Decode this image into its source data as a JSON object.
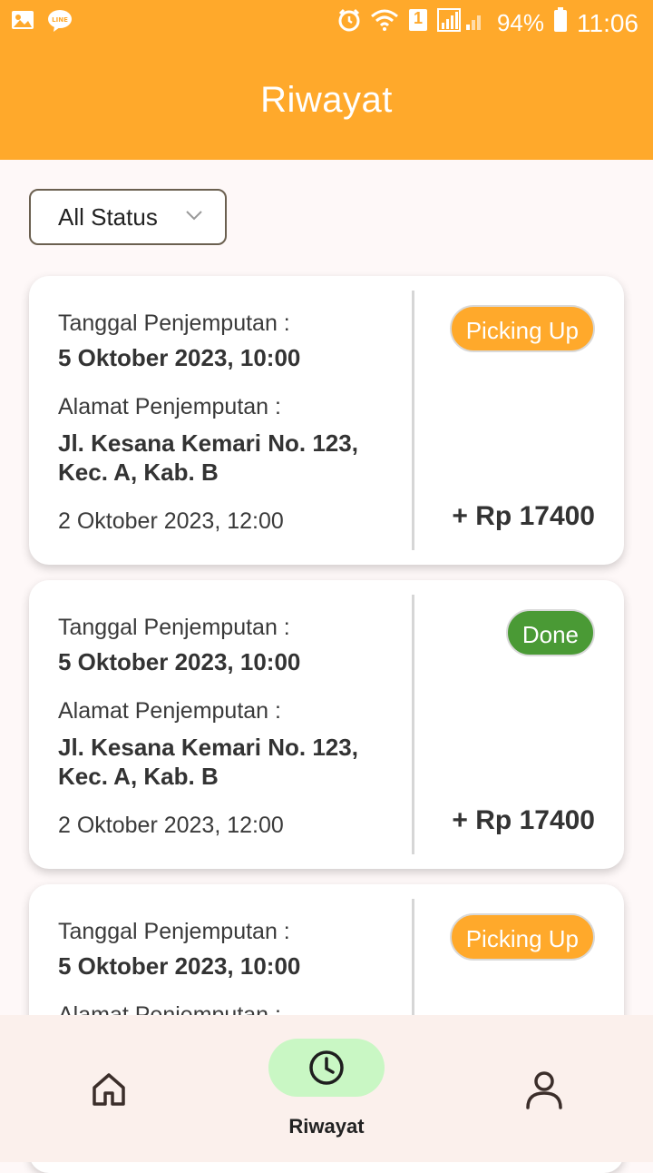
{
  "status_bar": {
    "battery": "94%",
    "time": "11:06",
    "sim": "1"
  },
  "header": {
    "title": "Riwayat"
  },
  "filter": {
    "selected": "All Status"
  },
  "cards": [
    {
      "pickup_label": "Tanggal Penjemputan :",
      "pickup_date": "5 Oktober 2023, 10:00",
      "address_label": "Alamat Penjemputan :",
      "address_line1": "Jl. Kesana Kemari No. 123,",
      "address_line2": "Kec. A, Kab. B",
      "created": "2 Oktober 2023, 12:00",
      "status": "Picking Up",
      "price": "+ Rp 17400"
    },
    {
      "pickup_label": "Tanggal Penjemputan :",
      "pickup_date": "5 Oktober 2023, 10:00",
      "address_label": "Alamat Penjemputan :",
      "address_line1": "Jl. Kesana Kemari No. 123,",
      "address_line2": "Kec. A, Kab. B",
      "created": "2 Oktober 2023, 12:00",
      "status": "Done",
      "price": "+ Rp 17400"
    },
    {
      "pickup_label": "Tanggal Penjemputan :",
      "pickup_date": "5 Oktober 2023, 10:00",
      "address_label": "Alamat Penjemputan :",
      "status": "Picking Up"
    }
  ],
  "bottom_nav": {
    "items": [
      {
        "icon": "home-icon"
      },
      {
        "icon": "clock-icon",
        "label": "Riwayat",
        "active": true
      },
      {
        "icon": "profile-icon"
      }
    ]
  },
  "colors": {
    "primary": "#FFA92B",
    "done": "#4A9A35",
    "nav_active_pill": "#C9F7C4"
  }
}
